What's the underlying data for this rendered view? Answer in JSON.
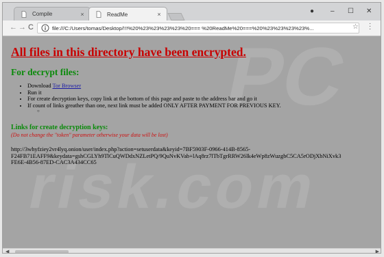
{
  "tabs": [
    {
      "label": "Compile",
      "close": "×"
    },
    {
      "label": "ReadMe",
      "close": "×"
    }
  ],
  "window_controls": {
    "minimize": "–",
    "maximize": "☐",
    "close": "✕",
    "profile": "●"
  },
  "nav": {
    "back": "←",
    "forward": "→",
    "reload": "C"
  },
  "address": {
    "url": "file:///C:/Users/tomas/Desktop/!!!%20%23%23%23%23%20=== %20ReadMe%20===%20%23%23%23%23%..."
  },
  "page": {
    "heading": "All files in this directory have been encrypted.",
    "decrypt_title": "For decrypt files:",
    "steps": [
      {
        "prefix": "Download ",
        "link": "Tor Browser"
      },
      {
        "text": "Run it"
      },
      {
        "text": "For create decryption keys, copy link at the bottom of this page and paste to the address bar and go it"
      },
      {
        "text": "If count of links greather than one, next link must be added ONLY AFTER PAYMENT FOR PREVIOUS KEY."
      }
    ],
    "sub_bullet": "○",
    "links_title": "Links for create decryption keys:",
    "warning": "(Do not change the \"token\" parameter otherwise your data will be lost)",
    "decrypt_url": "http://3whyfziey2vr4lyq.onion/user/index.php?action=setuserdata&keyid=7BF5903F-0966-414B-8565-\nF24FB71EAFF9&keydata=gshCGLYh9TlCuQWDdxNZLetPQ/9QuNvKVab+lAq8rz7lTbTgrRRW26lk4eWp8zWuzgbC5CA5rODjXbNiXvk3\nFE6E-4B56-87ED-CAC3A434CC65"
  },
  "colors": {
    "heading": "#c80000",
    "green_titles": "#0a8a0a",
    "link": "#1a1aa6",
    "content_bg": "#a4a4a4"
  }
}
